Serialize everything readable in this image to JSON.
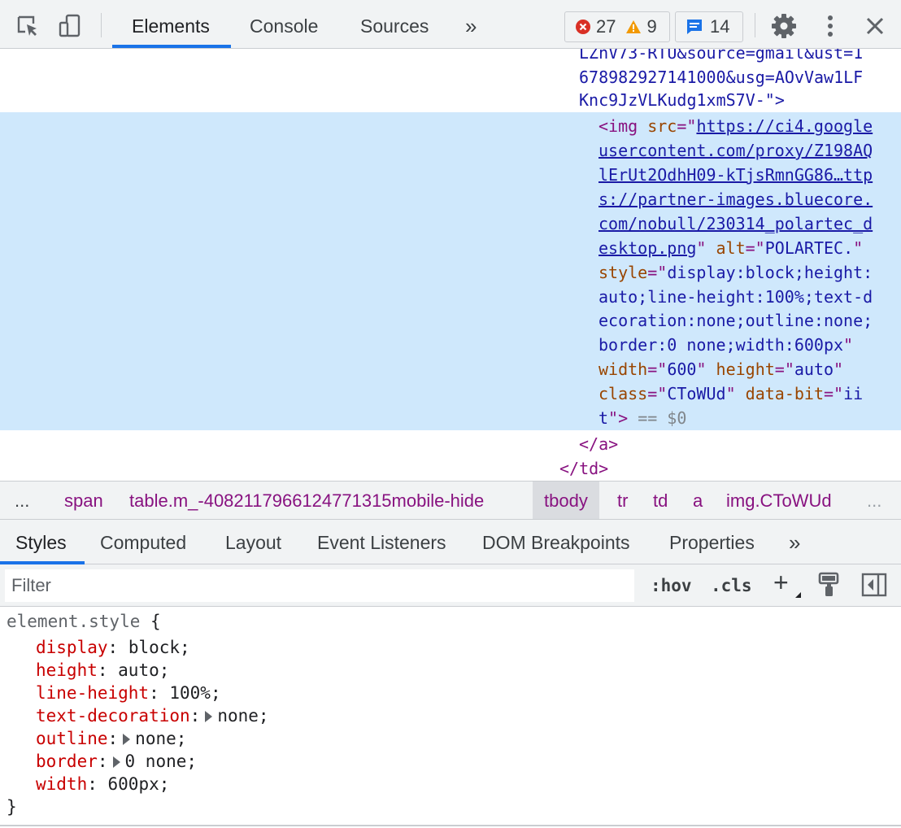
{
  "toolbar": {
    "tabs": [
      "Elements",
      "Console",
      "Sources"
    ],
    "more_tabs": "»",
    "errors": "27",
    "warnings": "9",
    "messages": "14"
  },
  "dom": {
    "prev_lines": [
      "LZnV73-RTU&source=gmail&ust=1",
      "678982927141000&usg=AOvVaw1LF",
      "Knc9JzVLKudg1xmS7V-\">"
    ],
    "img_tag": "<img",
    "src_attr": "src",
    "src_lines": [
      "https://ci4.google",
      "usercontent.com/proxy/Z198AQ",
      "lErUt2OdhH09-kTjsRmnGG86…ttp",
      "s://partner-images.bluecore.",
      "com/nobull/230314_polartec_d",
      "esktop.png"
    ],
    "alt_attr": "alt",
    "alt_value": "POLARTEC.",
    "style_attr": "style",
    "style_lines": [
      "display:block;height:",
      "auto;line-height:100%;text-d",
      "ecoration:none;outline:none;",
      "border:0 none;width:600px"
    ],
    "width_attr": "width",
    "width_value": "600",
    "height_attr": "height",
    "height_value": "auto",
    "class_attr": "class",
    "class_value": "CToWUd",
    "databit_attr": "data-bit",
    "databit_value_part1": "ii",
    "databit_value_part2": "t",
    "selected_marker": "== $0",
    "close_a": "</a>",
    "close_td": "</td>"
  },
  "breadcrumb": {
    "leading": "...",
    "items": [
      "span",
      "table.m_-4082117966124771315mobile-hide",
      "tbody",
      "tr",
      "td",
      "a",
      "img.CToWUd"
    ],
    "trailing": "..."
  },
  "panel_tabs": [
    "Styles",
    "Computed",
    "Layout",
    "Event Listeners",
    "DOM Breakpoints",
    "Properties"
  ],
  "panel_more": "»",
  "filter": {
    "placeholder": "Filter",
    "hov": ":hov",
    "cls": ".cls",
    "add": "+"
  },
  "styles": {
    "selector": "element.style",
    "open_brace": "{",
    "close_brace": "}",
    "declarations": [
      {
        "prop": "display",
        "value": "block;",
        "expandable": false
      },
      {
        "prop": "height",
        "value": "auto;",
        "expandable": false
      },
      {
        "prop": "line-height",
        "value": "100%;",
        "expandable": false
      },
      {
        "prop": "text-decoration",
        "value": "none;",
        "expandable": true
      },
      {
        "prop": "outline",
        "value": "none;",
        "expandable": true
      },
      {
        "prop": "border",
        "value": "0 none;",
        "expandable": true
      },
      {
        "prop": "width",
        "value": "600px;",
        "expandable": false
      }
    ]
  },
  "colors": {
    "accent": "#1a73e8",
    "selection": "#cfe8fc",
    "error": "#d93025",
    "warning": "#f29900",
    "info": "#1a73e8"
  }
}
